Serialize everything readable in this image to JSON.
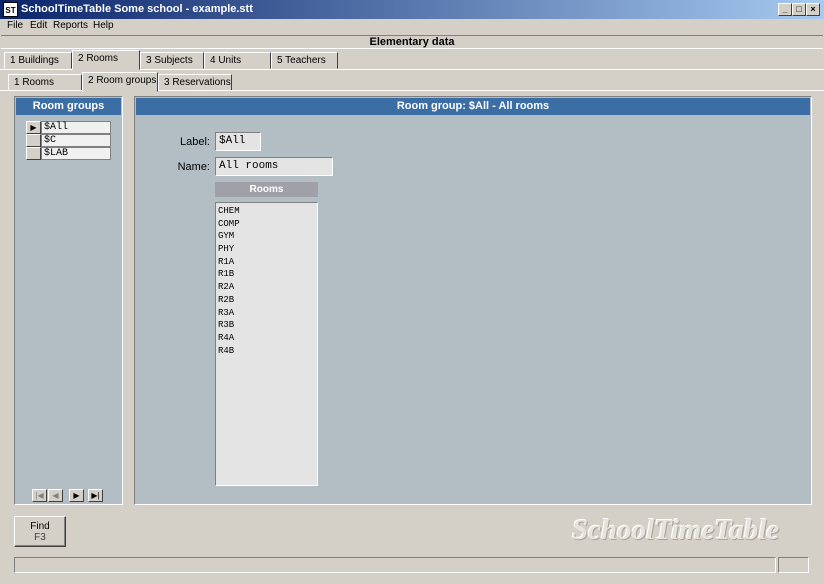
{
  "window": {
    "title": "SchoolTimeTable Some school - example.stt",
    "icon_text": "ST",
    "minimize_glyph": "_",
    "maximize_glyph": "□",
    "close_glyph": "×"
  },
  "menu": [
    "File",
    "Edit",
    "Reports",
    "Help"
  ],
  "header": {
    "title": "Elementary data"
  },
  "main_tabs": [
    "1  Buildings",
    "2  Rooms",
    "3 Subjects",
    "4    Units",
    "5 Teachers"
  ],
  "sub_tabs": [
    "1        Rooms",
    "2 Room groups",
    "3 Reservations"
  ],
  "left": {
    "title": "Room groups",
    "groups": [
      "$All",
      "$C",
      "$LAB"
    ],
    "current_indicator": "▶",
    "nav": [
      "|◀",
      "◀",
      "▶",
      "▶|"
    ]
  },
  "detail": {
    "title": "Room group:  $All - All rooms",
    "label_caption": "Label:",
    "label_value": "$All",
    "name_caption": "Name:",
    "name_value": "All rooms",
    "rooms_header": "Rooms",
    "rooms": [
      "CHEM",
      "COMP",
      "GYM",
      "PHY",
      "R1A",
      "R1B",
      "R2A",
      "R2B",
      "R3A",
      "R3B",
      "R4A",
      "R4B"
    ]
  },
  "find": {
    "label": "Find",
    "key": "F3"
  },
  "brand": "SchoolTimeTable"
}
